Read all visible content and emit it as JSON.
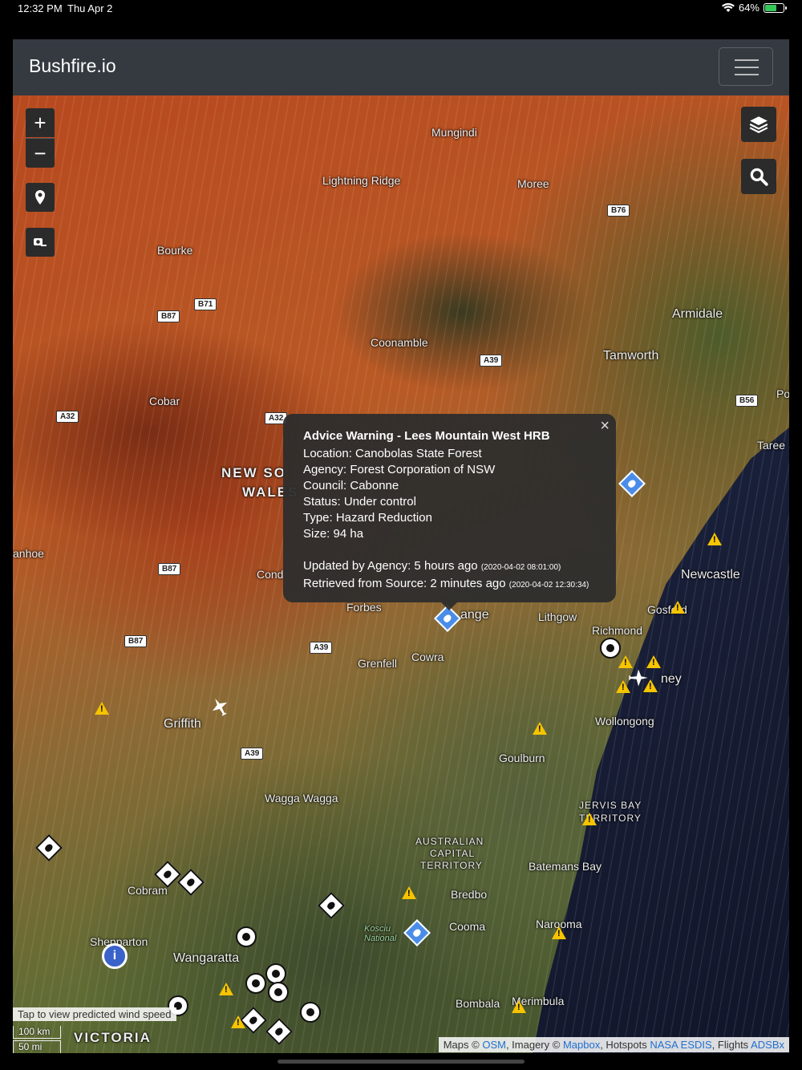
{
  "status_bar": {
    "time": "12:32 PM",
    "date": "Thu Apr 2",
    "battery": "64%"
  },
  "navbar": {
    "brand": "Bushfire.io",
    "menu_icon": "hamburger-icon"
  },
  "map_controls": {
    "zoom_in": "+",
    "zoom_out": "−",
    "icons": [
      "locate-icon",
      "camera-icon",
      "layers-icon",
      "search-icon"
    ]
  },
  "map_labels": {
    "mungindi": "Mungindi",
    "lightning_ridge": "Lightning Ridge",
    "moree": "Moree",
    "bourke": "Bourke",
    "armidale": "Armidale",
    "coonamble": "Coonamble",
    "tamworth": "Tamworth",
    "cobar": "Cobar",
    "po": "Po",
    "taree": "Taree",
    "nsw_1": "NEW SO",
    "nsw_2": "WALES",
    "anhoe": "anhoe",
    "newcastle": "Newcastle",
    "cond": "Cond",
    "forbes": "Forbes",
    "orange": "ange",
    "lithgow": "Lithgow",
    "gosford": "Gosford",
    "richmond": "Richmond",
    "grenfell": "Grenfell",
    "cowra": "Cowra",
    "sydney": "ney",
    "griffith": "Griffith",
    "wollongong": "Wollongong",
    "goulburn": "Goulburn",
    "wagga": "Wagga Wagga",
    "jervis_1": "JERVIS BAY",
    "jervis_2": "TERRITORY",
    "act_1": "AUSTRALIAN",
    "act_2": "CAPITAL",
    "act_3": "TERRITORY",
    "batemans": "Batemans Bay",
    "cobram": "Cobram",
    "bredbo": "Bredbo",
    "kosciuszko": "Kosciu National",
    "cooma": "Cooma",
    "narooma": "Narooma",
    "shepparton": "Shepparton",
    "wangaratta": "Wangaratta",
    "bombala": "Bombala",
    "merimbula": "Merimbula",
    "victoria": "VICTORIA"
  },
  "roads": [
    "B76",
    "B71",
    "B87",
    "A39",
    "B56",
    "A32",
    "A32",
    "B87",
    "B87",
    "A39",
    "A39"
  ],
  "popup": {
    "title": "Advice Warning - Lees Mountain West HRB",
    "location": "Location: Canobolas State Forest",
    "agency": "Agency: Forest Corporation of NSW",
    "council": "Council: Cabonne",
    "status": "Status: Under control",
    "type": "Type: Hazard Reduction",
    "size": "Size: 94 ha",
    "updated": "Updated by Agency: 5 hours ago",
    "updated_ts": "(2020-04-02 08:01:00)",
    "retrieved": "Retrieved from Source: 2 minutes ago",
    "retrieved_ts": "(2020-04-02 12:30:34)",
    "close": "×"
  },
  "wind_note": "Tap to view predicted wind speed",
  "scale": {
    "km": "100 km",
    "mi": "50 mi"
  },
  "attribution": {
    "prefix": "Maps ©",
    "osm": "OSM",
    "imagery": ", Imagery ©",
    "mapbox": "Mapbox",
    "hotspots": ", Hotspots",
    "nasa": "NASA ESDIS",
    "flights": ", Flights",
    "adsbx": "ADSBx"
  }
}
